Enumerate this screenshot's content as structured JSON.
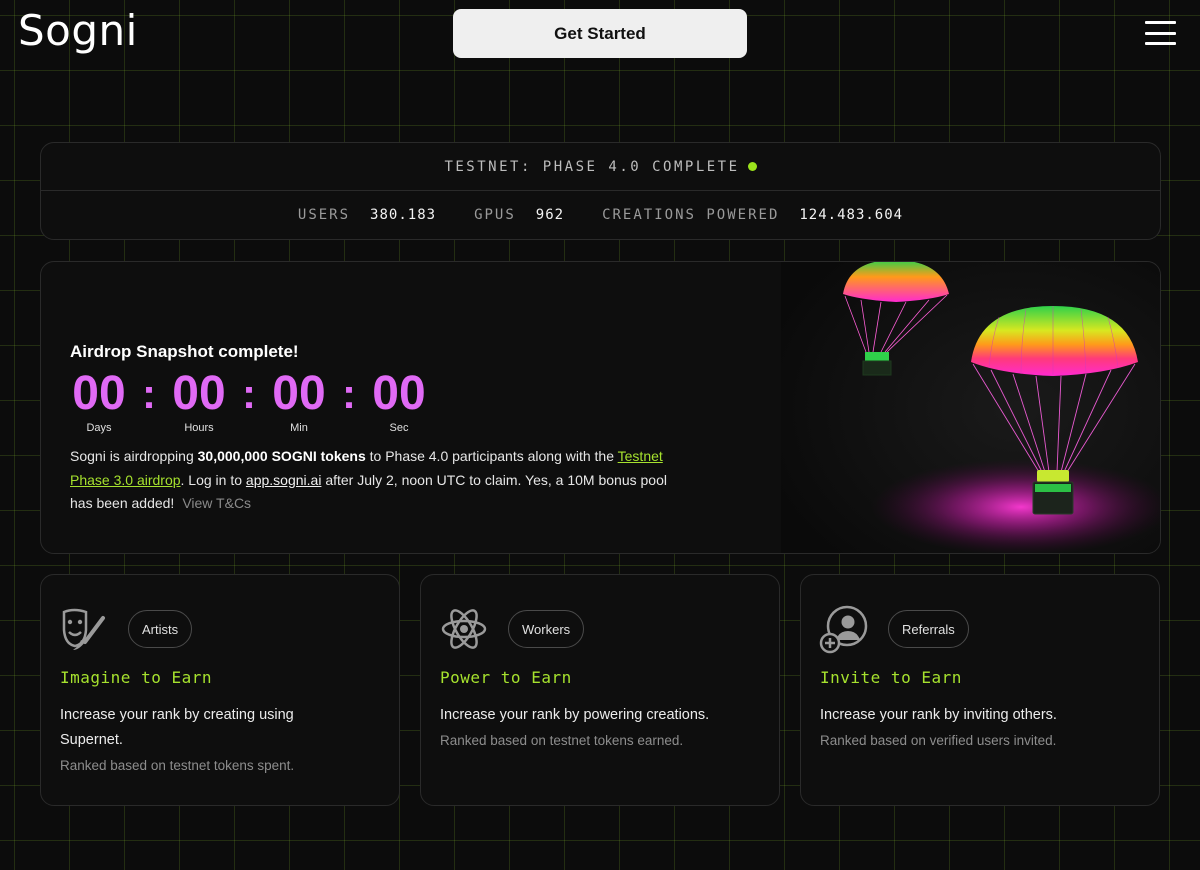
{
  "header": {
    "logo": "Sogni",
    "get_started_label": "Get Started",
    "menu_icon": "hamburger-menu-icon"
  },
  "stats": {
    "status_text": "TESTNET: PHASE 4.0 COMPLETE",
    "status_color": "#9be21c",
    "users_label": "USERS",
    "users_value": "380.183",
    "gpus_label": "GPUS",
    "gpus_value": "962",
    "creations_label": "CREATIONS POWERED",
    "creations_value": "124.483.604"
  },
  "airdrop": {
    "title": "Airdrop Snapshot complete!",
    "countdown": {
      "days": "00",
      "hours": "00",
      "min": "00",
      "sec": "00",
      "separator": ":",
      "days_label": "Days",
      "hours_label": "Hours",
      "min_label": "Min",
      "sec_label": "Sec"
    },
    "text_1": "Sogni is airdropping ",
    "text_bold": "30,000,000 SOGNI tokens",
    "text_2": " to Phase 4.0 participants along with the ",
    "link_phase3": "Testnet Phase 3.0 airdrop",
    "text_3": ". Log in to ",
    "link_app": "app.sogni.ai",
    "text_4": " after July 2, noon UTC to claim. Yes, a 10M bonus pool has been added!",
    "link_terms": "View T&Cs",
    "accent_color": "#e06af5"
  },
  "cards": [
    {
      "icon": "artist-masks-icon",
      "pill": "Artists",
      "title": "Imagine to Earn",
      "desc": "Increase your rank by creating using Supernet.",
      "sub": "Ranked based on testnet tokens spent."
    },
    {
      "icon": "atom-icon",
      "pill": "Workers",
      "title": "Power to Earn",
      "desc": "Increase your rank by powering creations.",
      "sub": "Ranked based on testnet tokens earned."
    },
    {
      "icon": "add-user-icon",
      "pill": "Referrals",
      "title": "Invite to Earn",
      "desc": "Increase your rank by inviting others.",
      "sub": "Ranked based on verified users invited."
    }
  ]
}
